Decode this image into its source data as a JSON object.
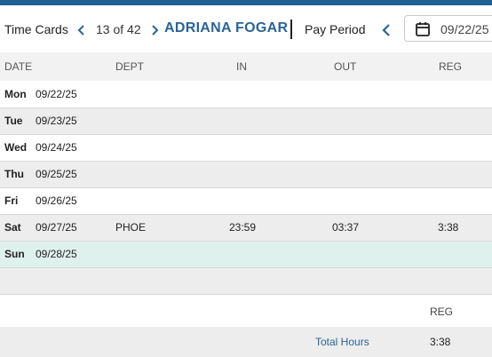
{
  "header": {
    "title": "Time Cards",
    "counter": "13 of 42",
    "employee_name": "ADRIANA FOGAR",
    "pay_period_label": "Pay Period",
    "pay_period_date": "09/22/25"
  },
  "colors": {
    "accent": "#2a6496",
    "top_bar": "#1f5f93",
    "current_row": "#dff1ec"
  },
  "table": {
    "columns": [
      "DATE",
      "DEPT",
      "IN",
      "OUT",
      "REG"
    ],
    "rows": [
      {
        "day": "Mon",
        "date": "09/22/25",
        "dept": "",
        "in": "",
        "out": "",
        "reg": ""
      },
      {
        "day": "Tue",
        "date": "09/23/25",
        "dept": "",
        "in": "",
        "out": "",
        "reg": ""
      },
      {
        "day": "Wed",
        "date": "09/24/25",
        "dept": "",
        "in": "",
        "out": "",
        "reg": ""
      },
      {
        "day": "Thu",
        "date": "09/25/25",
        "dept": "",
        "in": "",
        "out": "",
        "reg": ""
      },
      {
        "day": "Fri",
        "date": "09/26/25",
        "dept": "",
        "in": "",
        "out": "",
        "reg": ""
      },
      {
        "day": "Sat",
        "date": "09/27/25",
        "dept": "PHOE",
        "in": "23:59",
        "out": "03:37",
        "reg": "3:38"
      },
      {
        "day": "Sun",
        "date": "09/28/25",
        "dept": "",
        "in": "",
        "out": "",
        "reg": ""
      }
    ]
  },
  "summary": {
    "column_label": "REG",
    "total_label": "Total Hours",
    "total_reg": "3:38"
  }
}
